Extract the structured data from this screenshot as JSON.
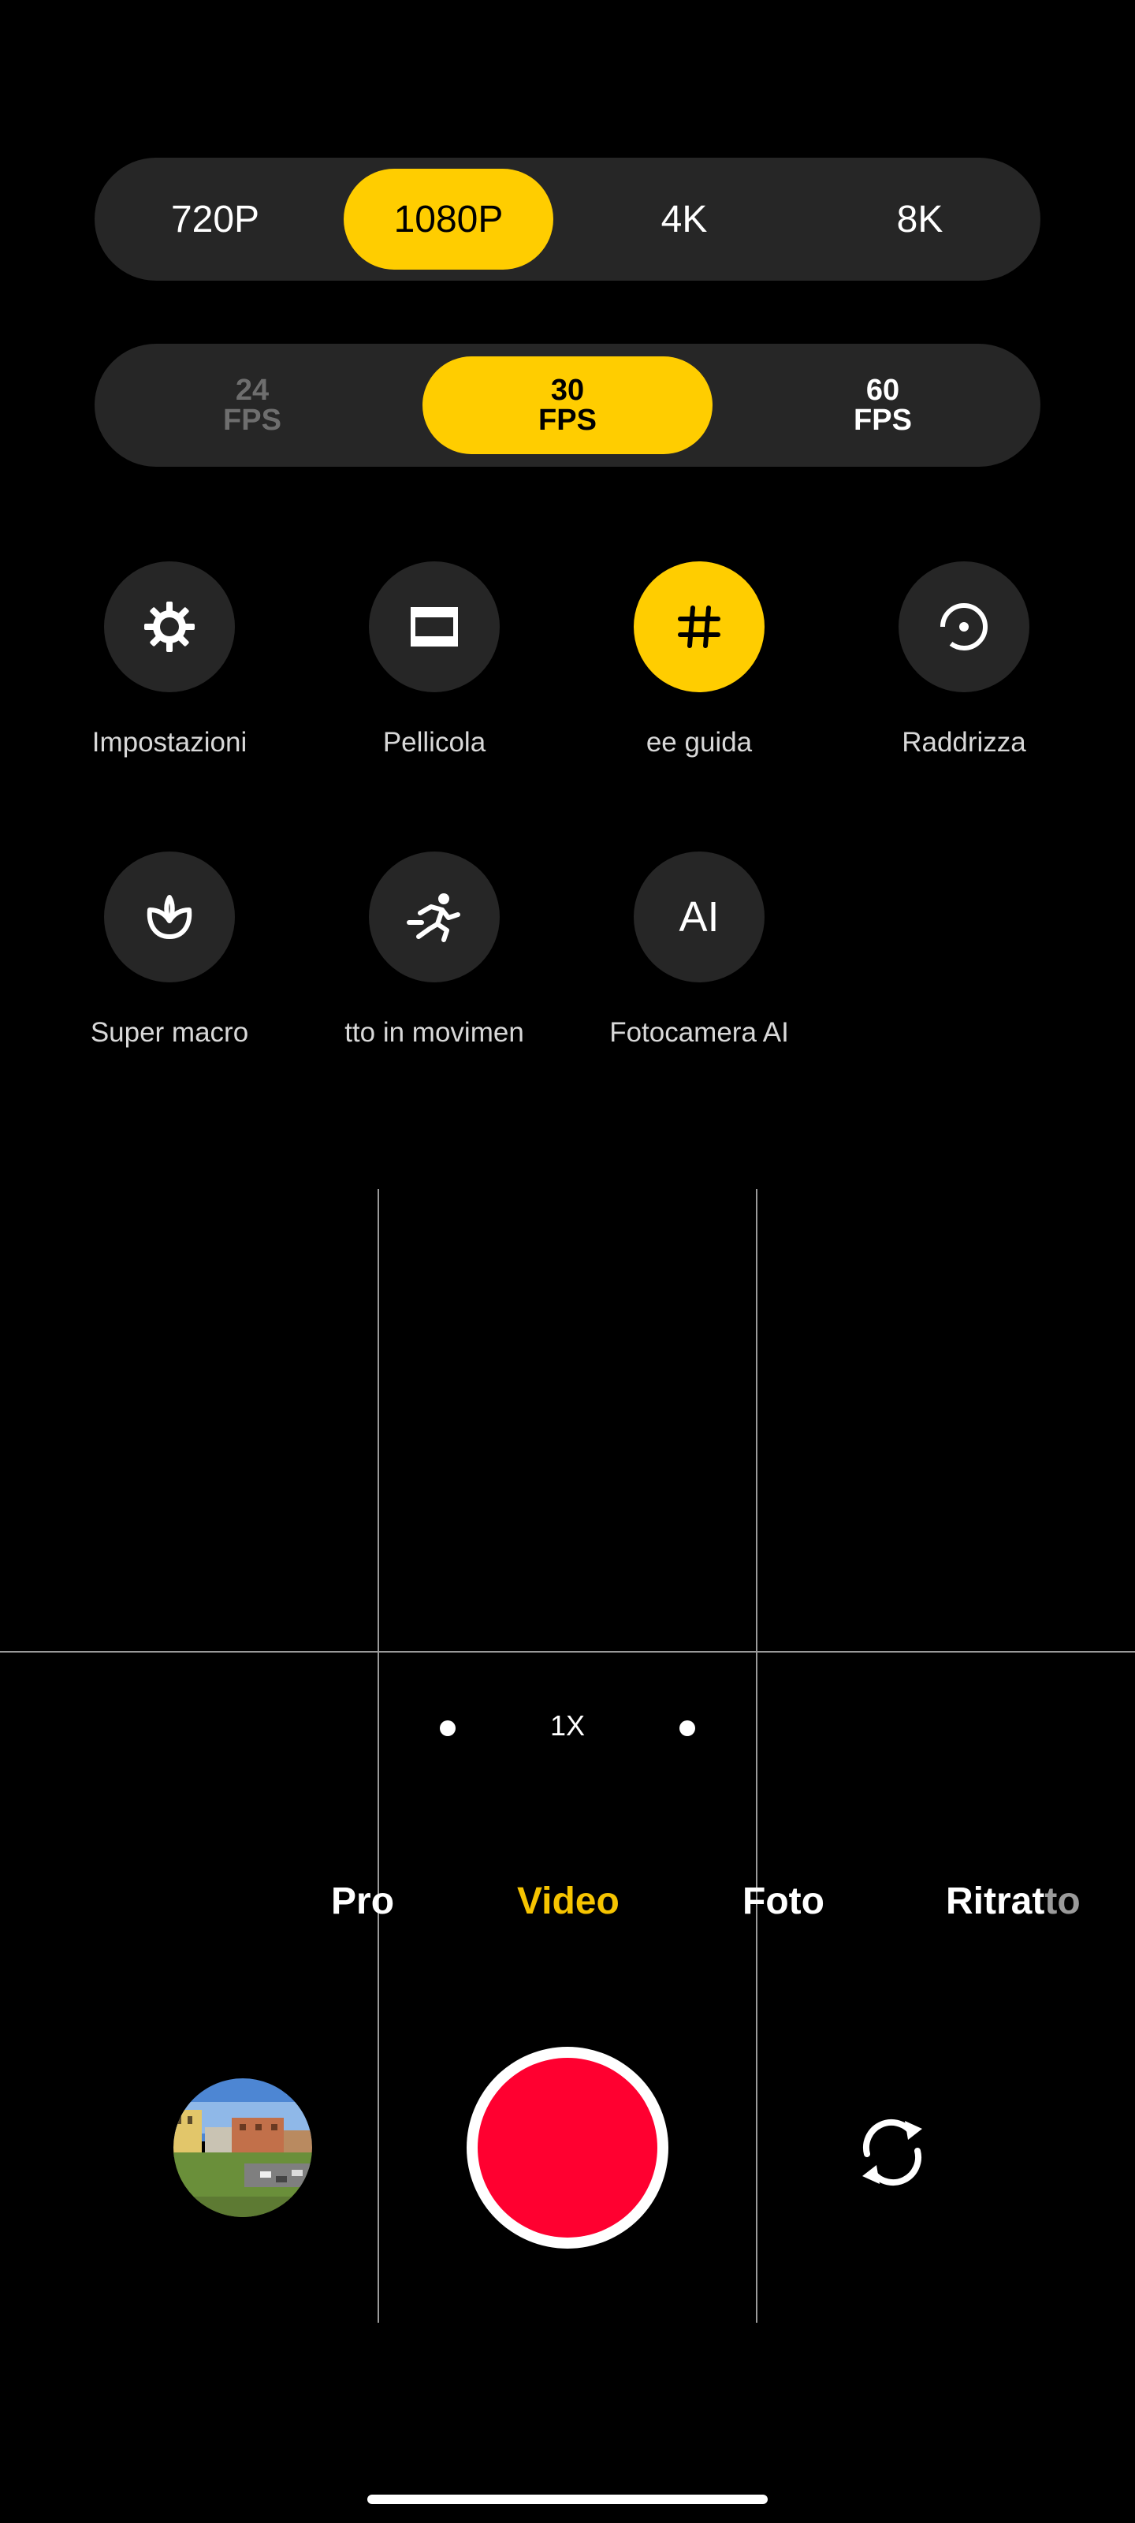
{
  "resolution": {
    "options": [
      "720P",
      "1080P",
      "4K",
      "8K"
    ],
    "selected": "1080P"
  },
  "fps": {
    "options": [
      {
        "value": "24",
        "unit": "FPS"
      },
      {
        "value": "30",
        "unit": "FPS"
      },
      {
        "value": "60",
        "unit": "FPS"
      }
    ],
    "selected": "30"
  },
  "features": [
    {
      "label": "Impostazioni",
      "icon": "gear-icon",
      "active": false
    },
    {
      "label": "Pellicola",
      "icon": "film-frame-icon",
      "active": false
    },
    {
      "label": "ee guida",
      "icon": "grid-hash-icon",
      "active": true
    },
    {
      "label": "Raddrizza",
      "icon": "level-icon",
      "active": false
    },
    {
      "label": "Super macro",
      "icon": "flower-macro-icon",
      "active": false
    },
    {
      "label": "tto in movimen",
      "icon": "running-figure-icon",
      "active": false
    },
    {
      "label": "Fotocamera AI",
      "icon": "ai-text-icon",
      "active": false
    }
  ],
  "ai_icon_text": "AI",
  "zoom": {
    "label": "1X"
  },
  "modes": {
    "items": [
      "Pro",
      "Video",
      "Foto",
      "Ritratto"
    ],
    "active": "Video",
    "ritratto_main": "Ritrat",
    "ritratto_tail": "to"
  },
  "colors": {
    "accent": "#ffcd00",
    "record": "#ff0030",
    "panel": "#262626",
    "background": "#000000"
  }
}
